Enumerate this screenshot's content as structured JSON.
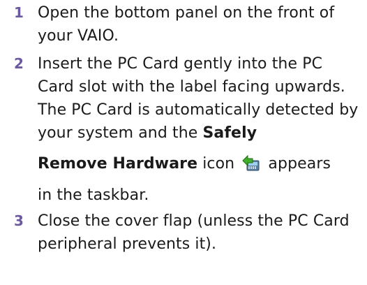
{
  "steps": [
    {
      "number": "1",
      "text": "Open the bottom panel on the front of your VAIO."
    },
    {
      "number": "2",
      "line_a": "Insert the PC Card gently into the PC Card slot with the label facing upwards.",
      "line_b_pre": "The PC Card is automatically detected by your system and the ",
      "bold_part1": "Safely",
      "bold_part2": "Remove Hardware",
      "icon_text": " icon ",
      "icon_name": "safely-remove-hardware-icon",
      "after_icon": " appears",
      "tail": "in the taskbar."
    },
    {
      "number": "3",
      "text": "Close the cover flap (unless the PC Card peripheral prevents it)."
    }
  ],
  "colors": {
    "step_number": "#6c5aa0",
    "text": "#1a1a1a"
  }
}
